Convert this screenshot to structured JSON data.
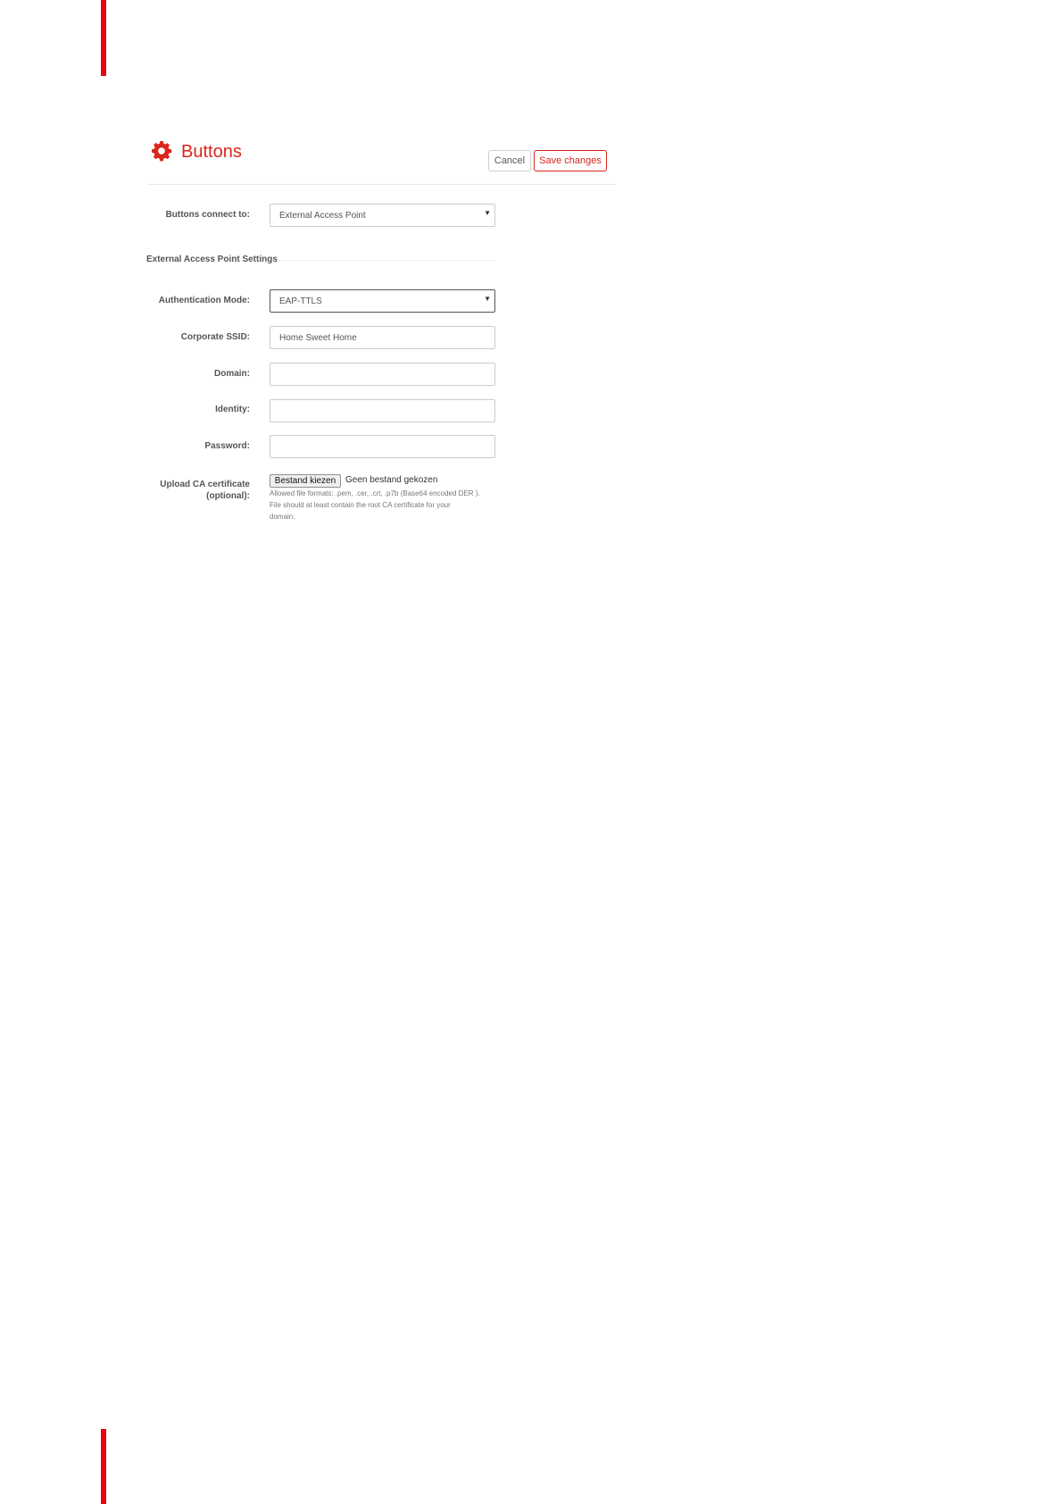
{
  "page": {
    "title": "Buttons",
    "icon": "gear-icon",
    "accent_color": "#d9261c",
    "edge_bar_color": "#e30613"
  },
  "actions": {
    "cancel_label": "Cancel",
    "save_label": "Save changes"
  },
  "form": {
    "connect": {
      "label": "Buttons connect to:",
      "value": "External Access Point"
    },
    "section_title": "External Access Point Settings",
    "auth_mode": {
      "label": "Authentication Mode:",
      "value": "EAP-TTLS"
    },
    "ssid": {
      "label": "Corporate SSID:",
      "value": "Home Sweet Home"
    },
    "domain": {
      "label": "Domain:",
      "value": ""
    },
    "identity": {
      "label": "Identity:",
      "value": ""
    },
    "password": {
      "label": "Password:",
      "value": ""
    },
    "certificate": {
      "label_line1": "Upload CA certificate",
      "label_line2": "(optional):",
      "choose_button": "Bestand kiezen",
      "status": "Geen bestand gekozen",
      "help_line1": "Allowed file formats: .pem, .cer, .crt, .p7b (Base64 encoded DER ).",
      "help_line2": "File should at least contain the root CA certificate for your",
      "help_line3": "domain."
    }
  }
}
